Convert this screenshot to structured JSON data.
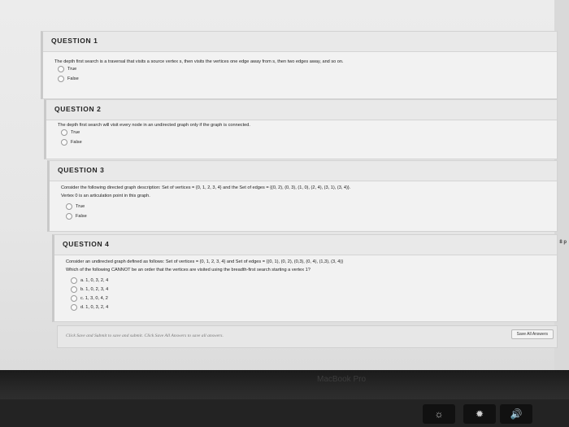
{
  "questions": [
    {
      "title": "QUESTION 1",
      "text_lines": [
        "The depth first search is a traversal that visits a source vertex s, then visits the vertices one edge away from s, then two edges away, and so on."
      ],
      "options": [
        "True",
        "False"
      ]
    },
    {
      "title": "QUESTION 2",
      "text_lines": [
        "The depth first search will visit every node in an undirected graph only if the graph is connected."
      ],
      "options": [
        "True",
        "False"
      ]
    },
    {
      "title": "QUESTION 3",
      "text_lines": [
        "Consider the following directed graph description: Set of vertices = {0, 1, 2, 3, 4} and the Set of edges = {(0, 2), (0, 3), (1, 0), (2, 4), (3, 1), (3, 4)}.",
        "Vertex 0 is an articulation point in this graph."
      ],
      "options": [
        "True",
        "False"
      ]
    },
    {
      "title": "QUESTION 4",
      "points": "8 p",
      "text_lines": [
        "Consider an undirected graph defined as follows:  Set of vertices = {0, 1, 2, 3, 4} and Set of edges = {(0, 1), (0, 2), (0,3), (0, 4), (1,3), (3, 4)}",
        "Which of the following CANNOT be an order that the vertices are visited using the breadth-first search starting a vertex 1?"
      ],
      "options": [
        "a. 1, 0, 3, 2, 4",
        "b. 1, 0, 2, 3, 4",
        "c. 1, 3, 0, 4, 2",
        "d. 1, 0, 3, 2, 4"
      ]
    }
  ],
  "footer": {
    "instructions": "Click Save and Submit to save and submit. Click Save All Answers to save all answers.",
    "save_all_label": "Save All Answers"
  },
  "laptop": {
    "brand": "MacBook Pro",
    "volume_icon": "speaker-icon"
  }
}
